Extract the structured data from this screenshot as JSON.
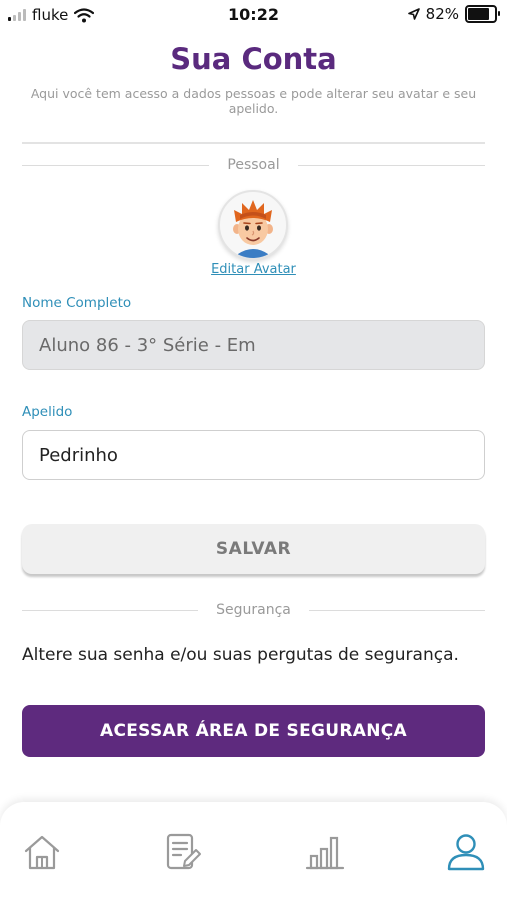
{
  "status_bar": {
    "carrier": "fluke",
    "time": "10:22",
    "battery_percent": "82%",
    "battery_level": 0.82,
    "icons": [
      "signal-icon",
      "wifi-icon",
      "location-icon",
      "battery-icon"
    ]
  },
  "header": {
    "title": "Sua Conta",
    "subtitle": "Aqui você tem acesso a dados pessoas e pode alterar seu avatar e seu apelido."
  },
  "personal": {
    "section_label": "Pessoal",
    "edit_avatar_label": "Editar Avatar",
    "full_name_label": "Nome Completo",
    "full_name_value": "Aluno 86 - 3° Série - Em",
    "nickname_label": "Apelido",
    "nickname_value": "Pedrinho",
    "save_label": "SALVAR"
  },
  "security": {
    "section_label": "Segurança",
    "description": "Altere sua senha e/ou suas pergutas de segurança.",
    "button_label": "ACESSAR ÁREA DE SEGURANÇA"
  },
  "bottom_nav": {
    "items": [
      {
        "icon": "home-icon",
        "active": false
      },
      {
        "icon": "edit-document-icon",
        "active": false
      },
      {
        "icon": "bar-chart-icon",
        "active": false
      },
      {
        "icon": "user-icon",
        "active": true
      }
    ]
  },
  "colors": {
    "brand_purple": "#5e2a7e",
    "label_blue": "#2f8fb8",
    "nav_inactive": "#9a9a9a",
    "nav_active": "#2f8fb8"
  }
}
